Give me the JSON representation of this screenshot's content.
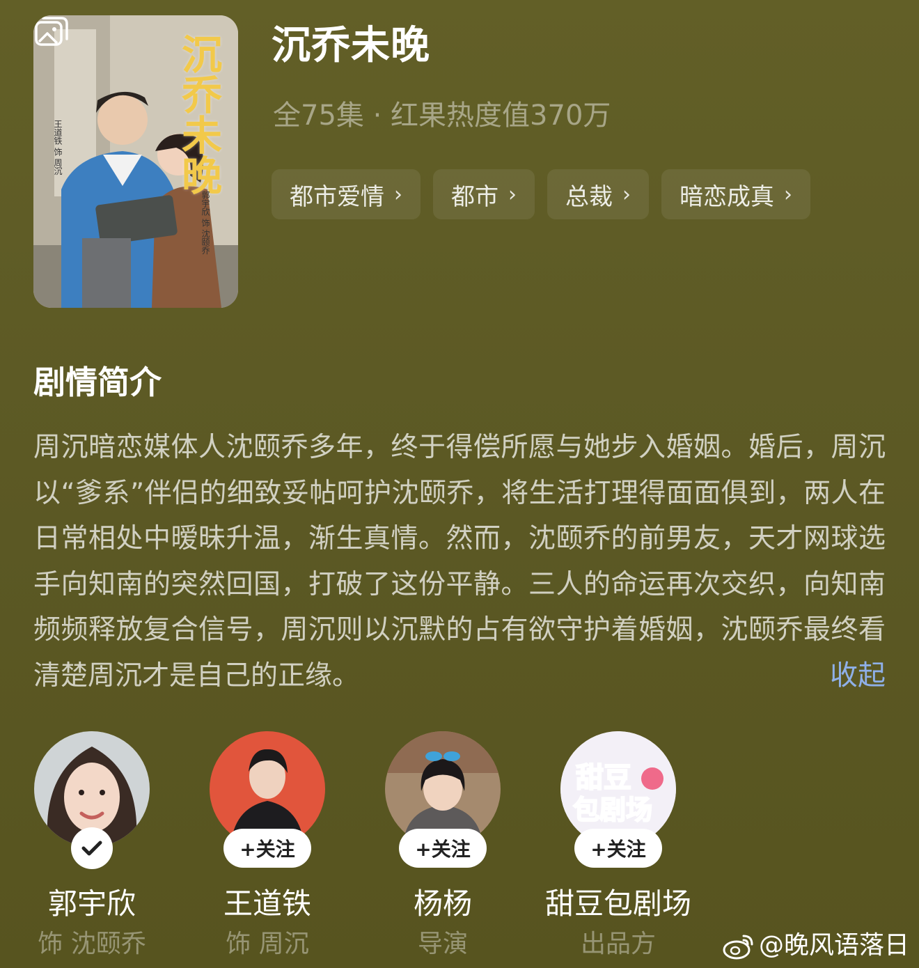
{
  "show": {
    "title": "沉乔未晚",
    "meta": "全75集 · 红果热度值370万",
    "poster_title": "沉乔未晚",
    "poster_credit_a": "王道铁 饰 周沉",
    "poster_credit_b": "郭宇欣 饰 沈颐乔"
  },
  "tags": [
    {
      "label": "都市爱情"
    },
    {
      "label": "都市"
    },
    {
      "label": "总裁"
    },
    {
      "label": "暗恋成真"
    }
  ],
  "synopsis": {
    "heading": "剧情简介",
    "text": "周沉暗恋媒体人沈颐乔多年，终于得偿所愿与她步入婚姻。婚后，周沉以“爹系”伴侣的细致妥帖呵护沈颐乔，将生活打理得面面俱到，两人在日常相处中暧昧升温，渐生真情。然而，沈颐乔的前男友，天才网球选手向知南的突然回国，打破了这份平静。三人的命运再次交织，向知南频频释放复合信号，周沉则以沉默的占有欲守护着婚姻，沈颐乔最终看清楚周沉才是自己的正缘。",
    "collapse_label": "收起"
  },
  "cast": [
    {
      "name": "郭宇欣",
      "role": "饰 沈颐乔",
      "followed": true
    },
    {
      "name": "王道铁",
      "role": "饰 周沉",
      "follow_label": "+关注"
    },
    {
      "name": "杨杨",
      "role": "导演",
      "follow_label": "+关注"
    },
    {
      "name": "甜豆包剧场",
      "role": "出品方",
      "follow_label": "+关注",
      "logo_line1": "甜豆",
      "logo_line2": "包剧场"
    }
  ],
  "watermark": "@晚风语落日",
  "colors": {
    "background": "#5e5b25",
    "link": "#8fb0e8",
    "poster_title": "#f2c94a"
  }
}
